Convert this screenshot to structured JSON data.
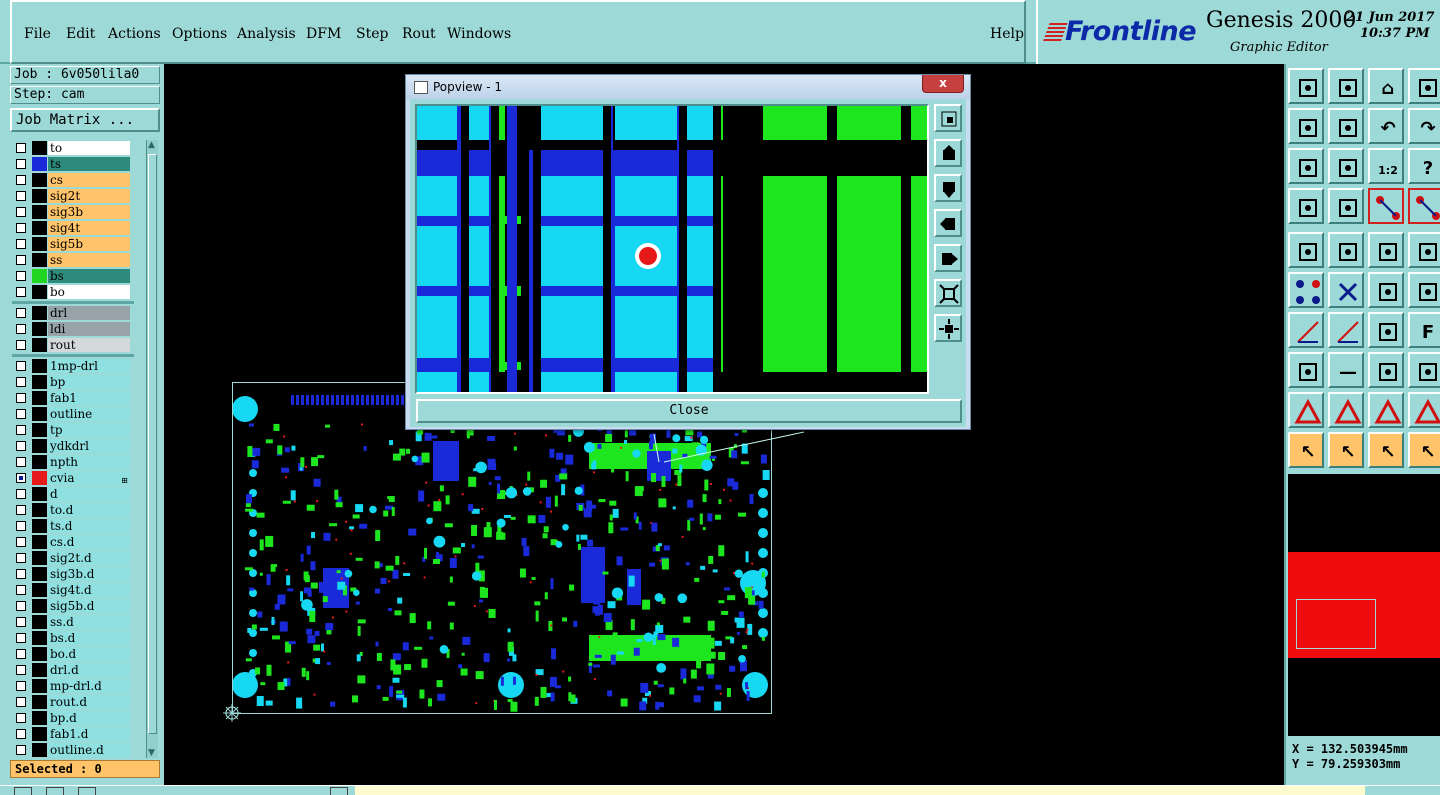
{
  "menubar": {
    "items": [
      "File",
      "Edit",
      "Actions",
      "Options",
      "Analysis",
      "DFM",
      "Step",
      "Rout",
      "Windows"
    ],
    "help": "Help"
  },
  "brand": {
    "logo": "Frontline",
    "product": "Genesis 2000",
    "subtitle": "Graphic Editor",
    "date": "21 Jun 2017",
    "time": "10:37 PM"
  },
  "job": {
    "job_label": "Job : 6v050lila0",
    "step_label": "Step: cam",
    "matrix_button": "Job Matrix ..."
  },
  "layers": [
    {
      "name": "to",
      "swatch": "#000000",
      "style": "white",
      "checked": false
    },
    {
      "name": "ts",
      "swatch": "#1a2ad8",
      "style": "teal",
      "checked": false
    },
    {
      "name": "cs",
      "swatch": "#000000",
      "style": "orange",
      "checked": false
    },
    {
      "name": "sig2t",
      "swatch": "#000000",
      "style": "orange",
      "checked": false
    },
    {
      "name": "sig3b",
      "swatch": "#000000",
      "style": "orange",
      "checked": false
    },
    {
      "name": "sig4t",
      "swatch": "#000000",
      "style": "orange",
      "checked": false
    },
    {
      "name": "sig5b",
      "swatch": "#000000",
      "style": "orange",
      "checked": false
    },
    {
      "name": "ss",
      "swatch": "#000000",
      "style": "orange",
      "checked": false
    },
    {
      "name": "bs",
      "swatch": "#21d621",
      "style": "teal",
      "checked": false
    },
    {
      "name": "bo",
      "swatch": "#000000",
      "style": "white",
      "checked": false
    },
    {
      "name": "drl",
      "swatch": "#000000",
      "style": "gray",
      "checked": false
    },
    {
      "name": "ldi",
      "swatch": "#000000",
      "style": "gray",
      "checked": false
    },
    {
      "name": "rout",
      "swatch": "#000000",
      "style": "lgray",
      "checked": false
    },
    {
      "name": "1mp-drl",
      "swatch": "#000000",
      "style": "cyan",
      "checked": false
    },
    {
      "name": "bp",
      "swatch": "#000000",
      "style": "cyan",
      "checked": false
    },
    {
      "name": "fab1",
      "swatch": "#000000",
      "style": "cyan",
      "checked": false
    },
    {
      "name": "outline",
      "swatch": "#000000",
      "style": "cyan",
      "checked": false
    },
    {
      "name": "tp",
      "swatch": "#000000",
      "style": "cyan",
      "checked": false
    },
    {
      "name": "ydkdrl",
      "swatch": "#000000",
      "style": "cyan",
      "checked": false
    },
    {
      "name": "npth",
      "swatch": "#000000",
      "style": "cyan",
      "checked": false
    },
    {
      "name": "cvia",
      "swatch": "#e61a1a",
      "style": "cyan",
      "checked": true,
      "mark": "⊞"
    },
    {
      "name": "d",
      "swatch": "#000000",
      "style": "cyan",
      "checked": false
    },
    {
      "name": "to.d",
      "swatch": "#000000",
      "style": "cyan",
      "checked": false
    },
    {
      "name": "ts.d",
      "swatch": "#000000",
      "style": "cyan",
      "checked": false
    },
    {
      "name": "cs.d",
      "swatch": "#000000",
      "style": "cyan",
      "checked": false
    },
    {
      "name": "sig2t.d",
      "swatch": "#000000",
      "style": "cyan",
      "checked": false
    },
    {
      "name": "sig3b.d",
      "swatch": "#000000",
      "style": "cyan",
      "checked": false
    },
    {
      "name": "sig4t.d",
      "swatch": "#000000",
      "style": "cyan",
      "checked": false
    },
    {
      "name": "sig5b.d",
      "swatch": "#000000",
      "style": "cyan",
      "checked": false
    },
    {
      "name": "ss.d",
      "swatch": "#000000",
      "style": "cyan",
      "checked": false
    },
    {
      "name": "bs.d",
      "swatch": "#000000",
      "style": "cyan",
      "checked": false
    },
    {
      "name": "bo.d",
      "swatch": "#000000",
      "style": "cyan",
      "checked": false
    },
    {
      "name": "drl.d",
      "swatch": "#000000",
      "style": "cyan",
      "checked": false
    },
    {
      "name": "mp-drl.d",
      "swatch": "#000000",
      "style": "cyan",
      "checked": false
    },
    {
      "name": "rout.d",
      "swatch": "#000000",
      "style": "cyan",
      "checked": false
    },
    {
      "name": "bp.d",
      "swatch": "#000000",
      "style": "cyan",
      "checked": false
    },
    {
      "name": "fab1.d",
      "swatch": "#000000",
      "style": "cyan",
      "checked": false
    },
    {
      "name": "outline.d",
      "swatch": "#000000",
      "style": "cyan",
      "checked": false
    }
  ],
  "selected_label": "Selected : 0",
  "popview": {
    "title": "Popview - 1",
    "close_x": "x",
    "close_button": "Close",
    "tools": [
      "zoom-fit-icon",
      "layer-up-icon",
      "layer-down-icon",
      "pan-left-icon",
      "pan-right-icon",
      "zoom-out-icon",
      "zoom-in-icon"
    ]
  },
  "coords": {
    "x_label": "X = 132.503945mm",
    "y_label": "Y = 79.259303mm"
  },
  "colors": {
    "panel": "#9dd9d6",
    "blue": "#1a2ad8",
    "cyan": "#16d8f2",
    "green": "#1ee61e",
    "red": "#e61a1a",
    "orange": "#ffc46a"
  }
}
